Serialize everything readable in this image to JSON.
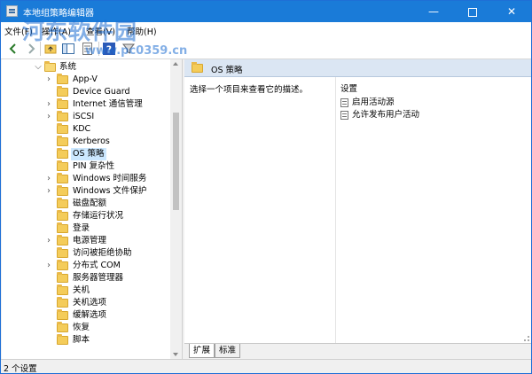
{
  "window": {
    "title": "本地组策略编辑器"
  },
  "menubar": {
    "items": [
      "文件(F)",
      "操作(A)",
      "查看(V)",
      "帮助(H)"
    ]
  },
  "watermark": {
    "text": "河东软件园",
    "url": "www.pc0359.cn"
  },
  "tree": {
    "items": [
      {
        "label": "系统",
        "expander": "⌵"
      },
      {
        "label": "App-V",
        "expander": "›"
      },
      {
        "label": "Device Guard",
        "expander": ""
      },
      {
        "label": "Internet 通信管理",
        "expander": "›"
      },
      {
        "label": "iSCSI",
        "expander": "›"
      },
      {
        "label": "KDC",
        "expander": ""
      },
      {
        "label": "Kerberos",
        "expander": ""
      },
      {
        "label": "OS 策略",
        "expander": ""
      },
      {
        "label": "PIN 复杂性",
        "expander": ""
      },
      {
        "label": "Windows 时间服务",
        "expander": "›"
      },
      {
        "label": "Windows 文件保护",
        "expander": "›"
      },
      {
        "label": "磁盘配额",
        "expander": ""
      },
      {
        "label": "存储运行状况",
        "expander": ""
      },
      {
        "label": "登录",
        "expander": ""
      },
      {
        "label": "电源管理",
        "expander": "›"
      },
      {
        "label": "访问被拒绝协助",
        "expander": ""
      },
      {
        "label": "分布式 COM",
        "expander": "›"
      },
      {
        "label": "服务器管理器",
        "expander": ""
      },
      {
        "label": "关机",
        "expander": ""
      },
      {
        "label": "关机选项",
        "expander": ""
      },
      {
        "label": "缓解选项",
        "expander": ""
      },
      {
        "label": "恢复",
        "expander": ""
      },
      {
        "label": "脚本",
        "expander": ""
      }
    ]
  },
  "detail": {
    "header": "OS 策略",
    "description": "选择一个项目来查看它的描述。",
    "column_header": "设置",
    "settings": [
      "启用活动源",
      "允许发布用户活动"
    ]
  },
  "tabs": [
    "扩展",
    "标准"
  ],
  "status": {
    "text": "2 个设置"
  },
  "colors": {
    "titlebar": "#1a7bd8",
    "selection": "#cce8ff",
    "header": "#dbe6f3"
  }
}
